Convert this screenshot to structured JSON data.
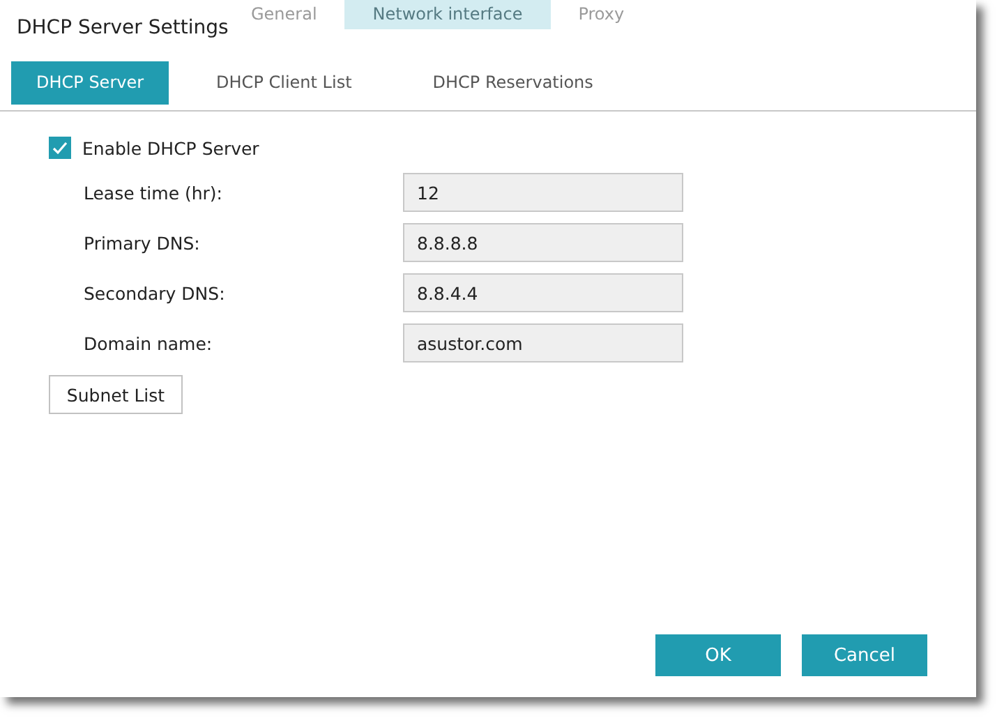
{
  "background_tabs": [
    {
      "label": "General",
      "selected": false
    },
    {
      "label": "Network interface",
      "selected": true
    },
    {
      "label": "Proxy",
      "selected": false
    }
  ],
  "window": {
    "title": "DHCP Server Settings"
  },
  "tabs": [
    {
      "label": "DHCP Server",
      "selected": true
    },
    {
      "label": "DHCP Client List",
      "selected": false
    },
    {
      "label": "DHCP Reservations",
      "selected": false
    }
  ],
  "enable_dhcp": {
    "label": "Enable DHCP Server",
    "checked": true
  },
  "fields": [
    {
      "label": "Lease time (hr):",
      "value": "12"
    },
    {
      "label": "Primary DNS:",
      "value": "8.8.8.8"
    },
    {
      "label": "Secondary DNS:",
      "value": "8.8.4.4"
    },
    {
      "label": "Domain name:",
      "value": "asustor.com"
    }
  ],
  "subnet_button": "Subnet List",
  "buttons": [
    "OK",
    "Cancel"
  ]
}
